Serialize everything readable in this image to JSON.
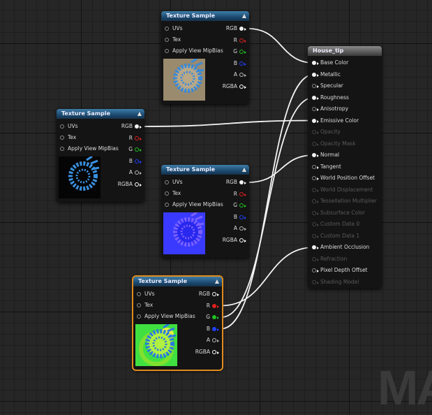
{
  "texture_nodes": [
    {
      "title": "Texture Sample",
      "inputs": [
        "UVs",
        "Tex",
        "Apply View MipBias"
      ],
      "outputs": [
        {
          "label": "RGB",
          "color": "#ffffff"
        },
        {
          "label": "R",
          "color": "#e02020"
        },
        {
          "label": "G",
          "color": "#20c020"
        },
        {
          "label": "B",
          "color": "#2040ff"
        },
        {
          "label": "A",
          "color": "#bbbbbb"
        },
        {
          "label": "RGBA",
          "color": "#ffffff"
        }
      ],
      "preview": "blue-rings-sepia"
    },
    {
      "title": "Texture Sample",
      "inputs": [
        "UVs",
        "Tex",
        "Apply View MipBias"
      ],
      "outputs": [
        {
          "label": "RGB",
          "color": "#ffffff"
        },
        {
          "label": "R",
          "color": "#e02020"
        },
        {
          "label": "G",
          "color": "#20c020"
        },
        {
          "label": "B",
          "color": "#2040ff"
        },
        {
          "label": "A",
          "color": "#bbbbbb"
        },
        {
          "label": "RGBA",
          "color": "#ffffff"
        }
      ],
      "preview": "blue-rings-black"
    },
    {
      "title": "Texture Sample",
      "inputs": [
        "UVs",
        "Tex",
        "Apply View MipBias"
      ],
      "outputs": [
        {
          "label": "RGB",
          "color": "#ffffff"
        },
        {
          "label": "R",
          "color": "#e02020"
        },
        {
          "label": "G",
          "color": "#20c020"
        },
        {
          "label": "B",
          "color": "#2040ff"
        },
        {
          "label": "A",
          "color": "#bbbbbb"
        },
        {
          "label": "RGBA",
          "color": "#ffffff"
        }
      ],
      "preview": "normal-map"
    },
    {
      "title": "Texture Sample",
      "inputs": [
        "UVs",
        "Tex",
        "Apply View MipBias"
      ],
      "outputs": [
        {
          "label": "RGB",
          "color": "#ffffff"
        },
        {
          "label": "R",
          "color": "#e02020"
        },
        {
          "label": "G",
          "color": "#20c020"
        },
        {
          "label": "B",
          "color": "#2040ff"
        },
        {
          "label": "A",
          "color": "#bbbbbb"
        },
        {
          "label": "RGBA",
          "color": "#ffffff"
        }
      ],
      "preview": "green-orm-map",
      "selected": true
    }
  ],
  "material_node": {
    "title": "House_tip",
    "inputs": [
      {
        "label": "Base Color",
        "enabled": true,
        "connected": true
      },
      {
        "label": "Metallic",
        "enabled": true,
        "connected": true
      },
      {
        "label": "Specular",
        "enabled": true,
        "connected": false
      },
      {
        "label": "Roughness",
        "enabled": true,
        "connected": true
      },
      {
        "label": "Anisotropy",
        "enabled": true,
        "connected": false
      },
      {
        "label": "Emissive Color",
        "enabled": true,
        "connected": true
      },
      {
        "label": "Opacity",
        "enabled": false,
        "connected": false
      },
      {
        "label": "Opacity Mask",
        "enabled": false,
        "connected": false
      },
      {
        "label": "Normal",
        "enabled": true,
        "connected": true
      },
      {
        "label": "Tangent",
        "enabled": true,
        "connected": false
      },
      {
        "label": "World Position Offset",
        "enabled": true,
        "connected": false
      },
      {
        "label": "World Displacement",
        "enabled": false,
        "connected": false
      },
      {
        "label": "Tessellation Multiplier",
        "enabled": false,
        "connected": false
      },
      {
        "label": "Subsurface Color",
        "enabled": false,
        "connected": false
      },
      {
        "label": "Custom Data 0",
        "enabled": false,
        "connected": false
      },
      {
        "label": "Custom Data 1",
        "enabled": false,
        "connected": false
      },
      {
        "label": "Ambient Occlusion",
        "enabled": true,
        "connected": true
      },
      {
        "label": "Refraction",
        "enabled": false,
        "connected": false
      },
      {
        "label": "Pixel Depth Offset",
        "enabled": true,
        "connected": false
      },
      {
        "label": "Shading Model",
        "enabled": false,
        "connected": false
      }
    ]
  },
  "connections": [
    {
      "from_node": 0,
      "from_pin": "RGB",
      "to": "Base Color"
    },
    {
      "from_node": 1,
      "from_pin": "RGB",
      "to": "Emissive Color"
    },
    {
      "from_node": 2,
      "from_pin": "RGB",
      "to": "Normal"
    },
    {
      "from_node": 3,
      "from_pin": "R",
      "to": "Ambient Occlusion"
    },
    {
      "from_node": 3,
      "from_pin": "G",
      "to": "Roughness"
    },
    {
      "from_node": 3,
      "from_pin": "B",
      "to": "Metallic"
    }
  ],
  "watermark": "MA"
}
